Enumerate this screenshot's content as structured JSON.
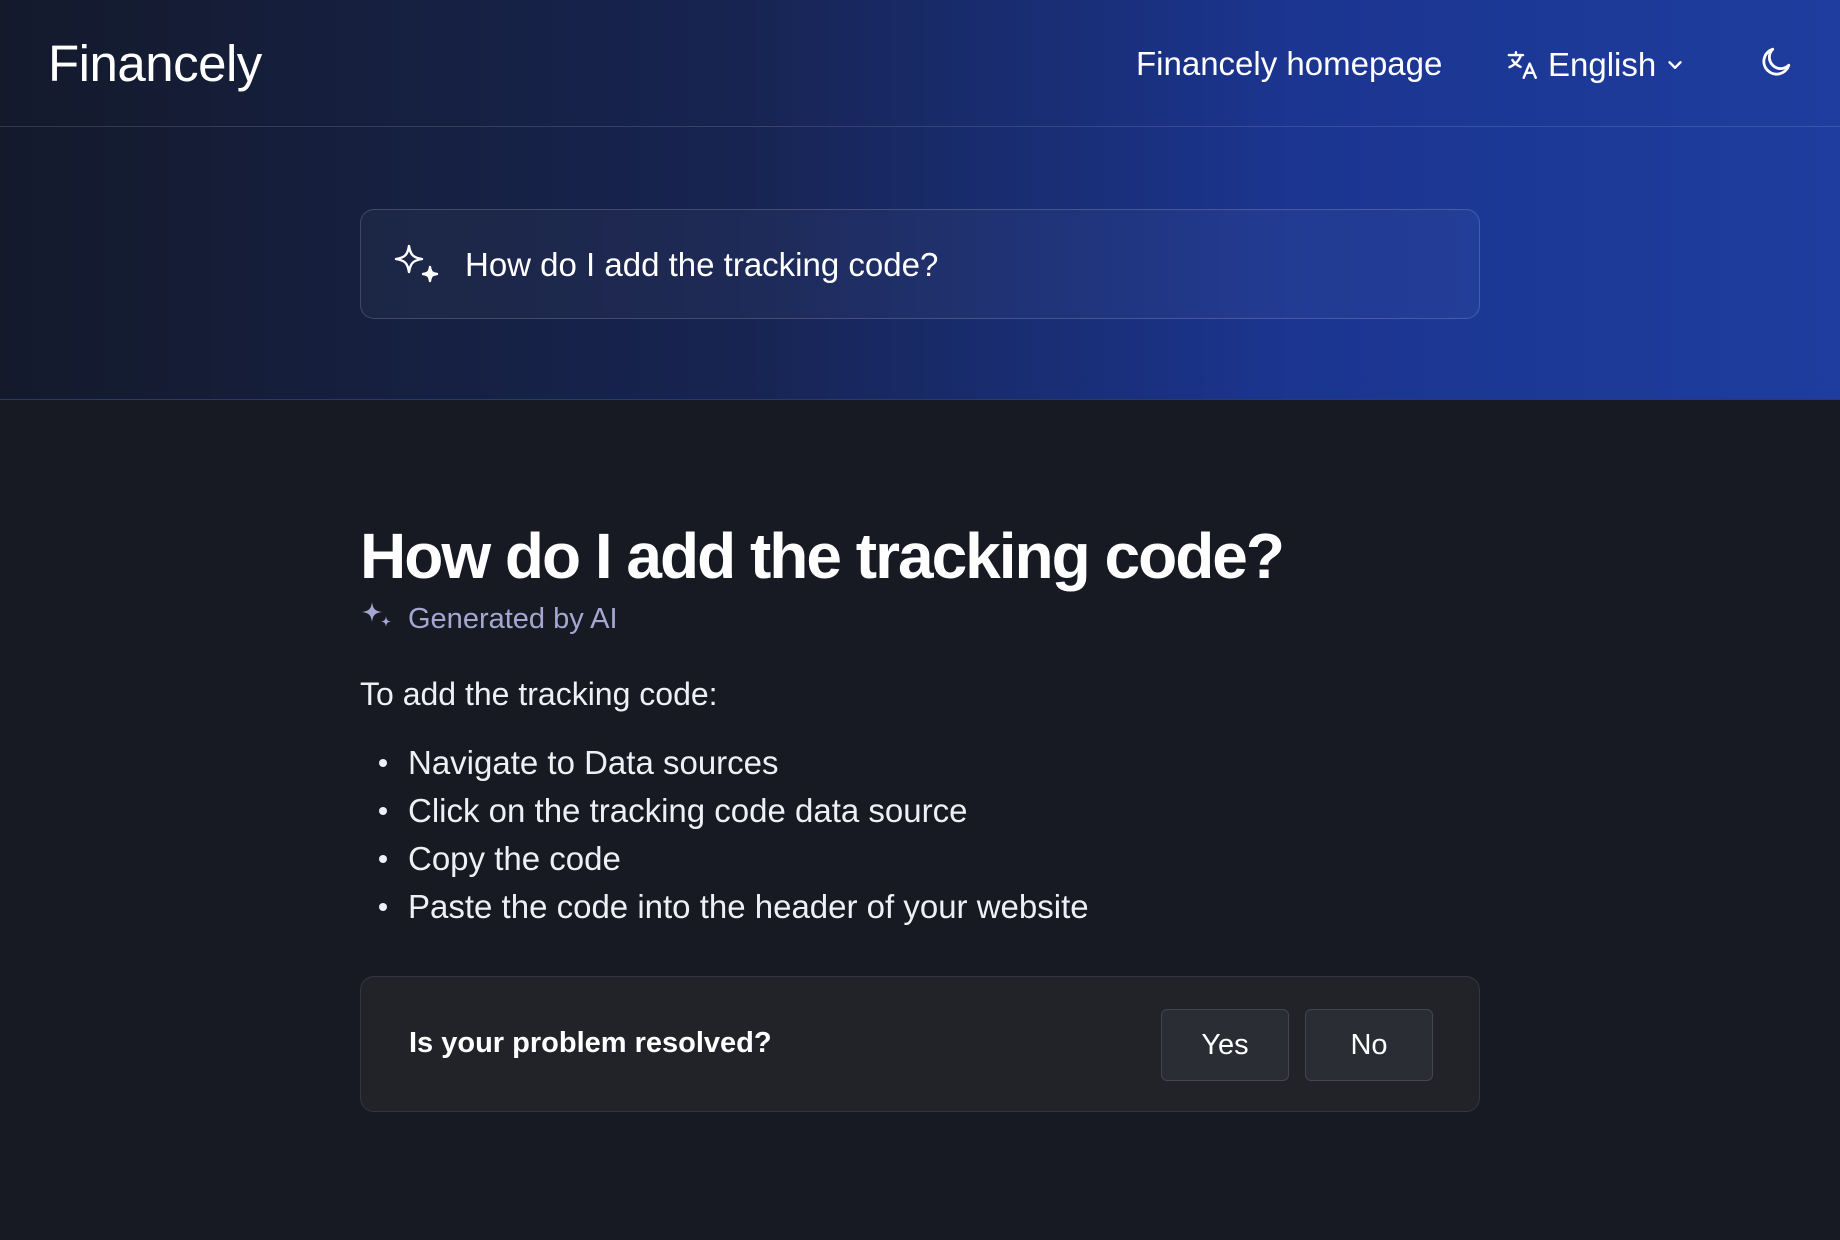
{
  "brand": {
    "name": "Financely"
  },
  "nav": {
    "homepage_link": "Financely homepage",
    "language": "English",
    "icons": [
      "translate-icon",
      "chevron-down-icon",
      "moon-icon"
    ]
  },
  "search": {
    "query": "How do I add the tracking code?",
    "icon": "sparkle-icon"
  },
  "article": {
    "title": "How do I add the tracking code?",
    "ai_label": "Generated by AI",
    "intro": "To add the tracking code:",
    "steps": [
      "Navigate to Data sources",
      "Click on the tracking code data source",
      "Copy the code",
      "Paste the code into the header of your website"
    ]
  },
  "feedback": {
    "question": "Is your problem resolved?",
    "yes_label": "Yes",
    "no_label": "No"
  },
  "colors": {
    "page_background": "#171a22",
    "hero_gradient_start": "#141a2c",
    "hero_gradient_end": "#1e3d9e",
    "ai_label": "#a7a6d3",
    "feedback_background": "#212329"
  }
}
